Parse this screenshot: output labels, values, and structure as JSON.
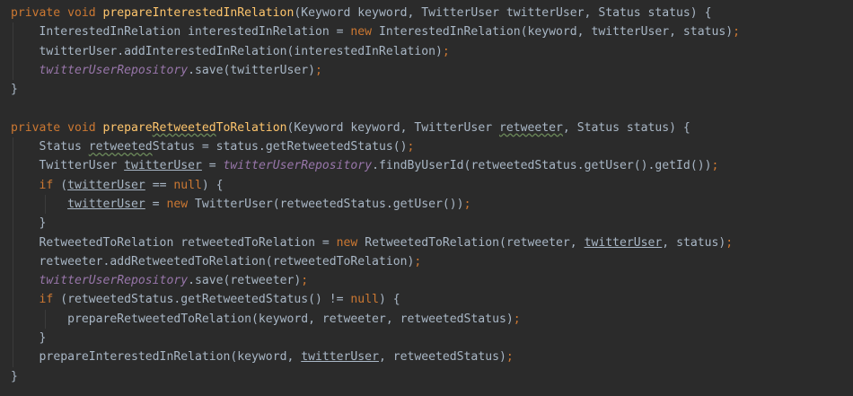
{
  "editor": {
    "colors": {
      "background": "#2b2b2b",
      "plain": "#a9b7c6",
      "keyword": "#cc7832",
      "method_declaration": "#ffc66d",
      "field": "#9876aa"
    },
    "lines": [
      {
        "indent": 0,
        "tokens": [
          {
            "t": "private void ",
            "c": "kw"
          },
          {
            "t": "prepareInterestedInRelation",
            "c": "fn"
          },
          {
            "t": "(Keyword keyword, TwitterUser twitterUser, Status status) {"
          }
        ]
      },
      {
        "indent": 1,
        "tokens": [
          {
            "t": "InterestedInRelation interestedInRelation = "
          },
          {
            "t": "new ",
            "c": "kw"
          },
          {
            "t": "InterestedInRelation(keyword, twitterUser, status)"
          },
          {
            "t": ";",
            "c": "kw"
          }
        ]
      },
      {
        "indent": 1,
        "tokens": [
          {
            "t": "twitterUser.addInterestedInRelation(interestedInRelation)"
          },
          {
            "t": ";",
            "c": "kw"
          }
        ]
      },
      {
        "indent": 1,
        "tokens": [
          {
            "t": "twitterUserRepository",
            "c": "fld"
          },
          {
            "t": ".save(twitterUser)"
          },
          {
            "t": ";",
            "c": "kw"
          }
        ]
      },
      {
        "indent": 0,
        "tokens": [
          {
            "t": "}"
          }
        ]
      },
      {
        "indent": 0,
        "tokens": []
      },
      {
        "indent": 0,
        "tokens": [
          {
            "t": "private void ",
            "c": "kw"
          },
          {
            "t": "prepare",
            "c": "fn"
          },
          {
            "t": "Retweeted",
            "c": "fn wv"
          },
          {
            "t": "ToRelation",
            "c": "fn"
          },
          {
            "t": "(Keyword keyword, TwitterUser "
          },
          {
            "t": "retweeter",
            "c": "wv"
          },
          {
            "t": ", Status status) {"
          }
        ]
      },
      {
        "indent": 1,
        "tokens": [
          {
            "t": "Status "
          },
          {
            "t": "retweeted",
            "c": "wv"
          },
          {
            "t": "Status = status.getRetweetedStatus()"
          },
          {
            "t": ";",
            "c": "kw"
          }
        ]
      },
      {
        "indent": 1,
        "tokens": [
          {
            "t": "TwitterUser "
          },
          {
            "t": "twitterUser",
            "c": "ul"
          },
          {
            "t": " = "
          },
          {
            "t": "twitterUserRepository",
            "c": "fld"
          },
          {
            "t": ".findByUserId(retweetedStatus.getUser().getId())"
          },
          {
            "t": ";",
            "c": "kw"
          }
        ]
      },
      {
        "indent": 1,
        "tokens": [
          {
            "t": "if ",
            "c": "kw"
          },
          {
            "t": "("
          },
          {
            "t": "twitterUser",
            "c": "ul"
          },
          {
            "t": " == "
          },
          {
            "t": "null",
            "c": "kw"
          },
          {
            "t": ") {"
          }
        ]
      },
      {
        "indent": 2,
        "tokens": [
          {
            "t": "twitterUser",
            "c": "ul"
          },
          {
            "t": " = "
          },
          {
            "t": "new ",
            "c": "kw"
          },
          {
            "t": "TwitterUser(retweetedStatus.getUser())"
          },
          {
            "t": ";",
            "c": "kw"
          }
        ]
      },
      {
        "indent": 1,
        "tokens": [
          {
            "t": "}"
          }
        ]
      },
      {
        "indent": 1,
        "tokens": [
          {
            "t": "RetweetedToRelation retweetedToRelation = "
          },
          {
            "t": "new ",
            "c": "kw"
          },
          {
            "t": "RetweetedToRelation(retweeter, "
          },
          {
            "t": "twitterUser",
            "c": "ul"
          },
          {
            "t": ", status)"
          },
          {
            "t": ";",
            "c": "kw"
          }
        ]
      },
      {
        "indent": 1,
        "tokens": [
          {
            "t": "retweeter.addRetweetedToRelation(retweetedToRelation)"
          },
          {
            "t": ";",
            "c": "kw"
          }
        ]
      },
      {
        "indent": 1,
        "tokens": [
          {
            "t": "twitterUserRepository",
            "c": "fld"
          },
          {
            "t": ".save(retweeter)"
          },
          {
            "t": ";",
            "c": "kw"
          }
        ]
      },
      {
        "indent": 1,
        "tokens": [
          {
            "t": "if ",
            "c": "kw"
          },
          {
            "t": "(retweetedStatus.getRetweetedStatus() != "
          },
          {
            "t": "null",
            "c": "kw"
          },
          {
            "t": ") {"
          }
        ]
      },
      {
        "indent": 2,
        "tokens": [
          {
            "t": "prepareRetweetedToRelation(keyword, retweeter, retweetedStatus)"
          },
          {
            "t": ";",
            "c": "kw"
          }
        ]
      },
      {
        "indent": 1,
        "tokens": [
          {
            "t": "}"
          }
        ]
      },
      {
        "indent": 1,
        "tokens": [
          {
            "t": "prepareInterestedInRelation(keyword, "
          },
          {
            "t": "twitterUser",
            "c": "ul"
          },
          {
            "t": ", retweetedStatus)"
          },
          {
            "t": ";",
            "c": "kw"
          }
        ]
      },
      {
        "indent": 0,
        "tokens": [
          {
            "t": "}"
          }
        ]
      }
    ]
  }
}
